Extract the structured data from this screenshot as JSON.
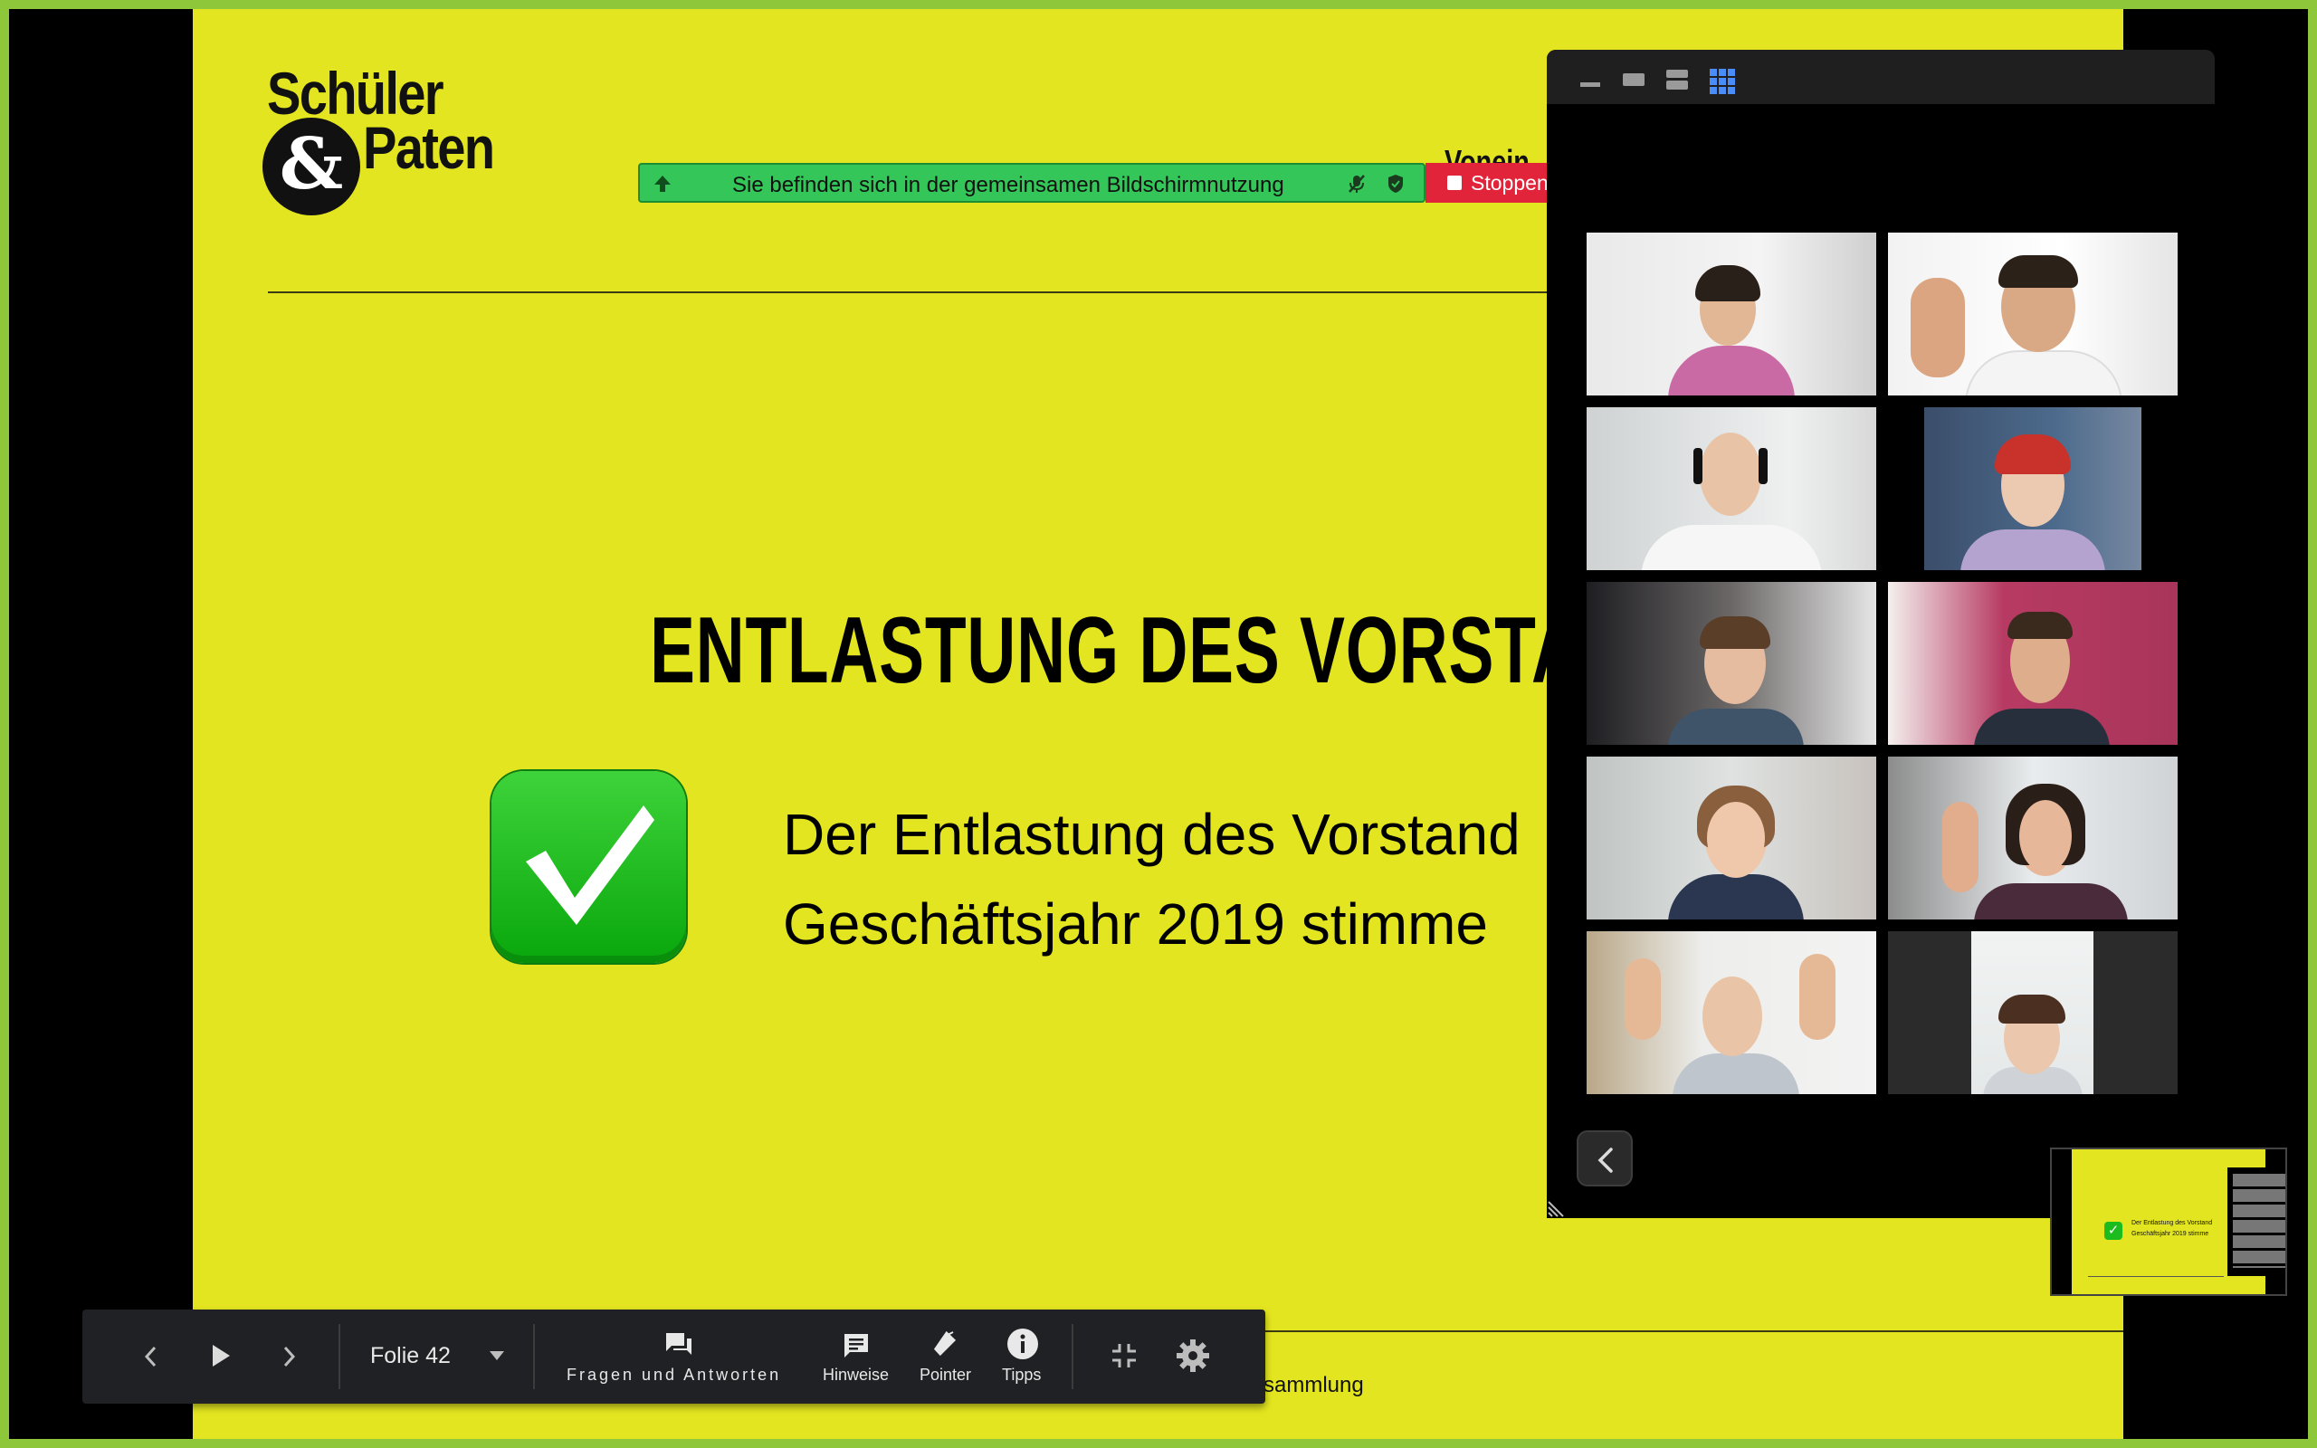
{
  "slide": {
    "logo_word1": "Schüler",
    "logo_amp": "&",
    "logo_word2": "Paten",
    "topright_text": "Vonein",
    "title": "ENTLASTUNG DES VORSTANI",
    "body_line_1": "Der Entlastung des Vorstand",
    "body_line_2": "Geschäftsjahr 2019 stimme",
    "footer_text": "sammlung",
    "background_color": "#e3e520"
  },
  "share_banner": {
    "text": "Sie befinden sich in der gemeinsamen Bildschirmnutzung",
    "stop_label": "Stoppen",
    "banner_color": "#34c658",
    "stop_color": "#e2243a"
  },
  "gallery": {
    "view_controls": [
      "minimize-icon",
      "single-view-icon",
      "speaker-view-icon",
      "gallery-view-icon"
    ],
    "participant_count": 10
  },
  "presenter_toolbar": {
    "slide_label": "Folie 42",
    "qa_label": "Fragen und Antworten",
    "notes_label": "Hinweise",
    "pointer_label": "Pointer",
    "tips_label": "Tipps"
  },
  "thumbnail": {
    "line1": "Der Entlastung des Vorstand",
    "line2": "Geschäftsjahr 2019 stimme"
  },
  "colors": {
    "screen_border": "#8ec73a",
    "toolbar_bg": "#202124",
    "gallery_active_icon": "#4a8df8"
  }
}
